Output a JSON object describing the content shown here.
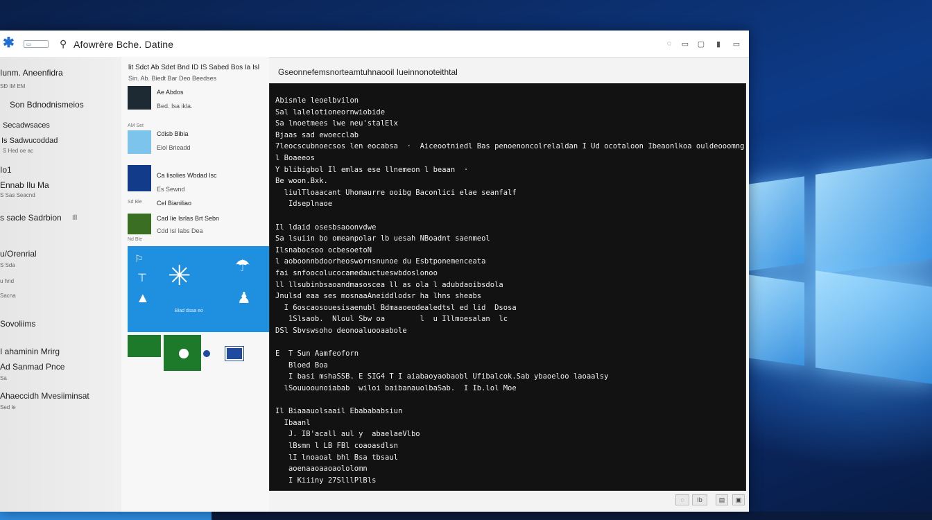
{
  "window": {
    "title": "Afowrère Bche. Datine",
    "small_control": "▭",
    "controls": [
      "◌",
      "▭",
      "▢",
      "▮",
      "▭"
    ]
  },
  "sidebar": {
    "items": [
      {
        "label": "Iunm. Aneenfidra",
        "sub": "SÐ IM EM"
      },
      {
        "label": "Son Bdnodnismeios",
        "sub": ""
      },
      {
        "label": "Secadwsaces",
        "sub": ""
      },
      {
        "label": "Is Sadwucoddad",
        "sub": "S Hed oe ac"
      },
      {
        "label": "Io1",
        "sub": ""
      },
      {
        "label": "Ennab Ilu Ma",
        "sub": "S Sas Seacnd"
      },
      {
        "label": "s sacle Sadrbion",
        "sub": "Ill"
      },
      {
        "label": "u/Orenrial",
        "sub": "S Sda"
      },
      {
        "label": "",
        "sub": "u hnd"
      },
      {
        "label": "",
        "sub": "Sacna"
      },
      {
        "label": "Sovoliims",
        "sub": ""
      },
      {
        "label": "I ahaminin Mrirg",
        "sub": ""
      },
      {
        "label": "Ad Sanmad Pnce",
        "sub": "Sa"
      },
      {
        "label": "Ahaeccidh Mvesiiminsat",
        "sub": "Sed le"
      }
    ]
  },
  "list": {
    "header": "lit Sdct  Ab Sdet Bnd  ID IS Sabed  Bos Ia Isl",
    "sub": "Sin.  Ab. Biedt Bar  Deo Beedses",
    "rows": [
      {
        "title": "Ae Abdos",
        "sub": "Bed. Isa ikla.",
        "tag": ""
      },
      {
        "title": "Cdisb Bibia",
        "sub": "Eiol Brieadd",
        "tag": "AM Set"
      },
      {
        "title": "Ca Iisolies Wbdad Isc",
        "sub": "Es Sewnd",
        "tag": ""
      },
      {
        "title": "Cel Bianiliao",
        "sub": "",
        "tag": "Sd Ble"
      },
      {
        "title": "Cad  Iie Isrlas Brt Sebn",
        "sub": "Cdd  Isl  Iabs  Dea",
        "tag": "Nd Ble"
      }
    ],
    "tile_caption": "Biad dsaa eo"
  },
  "content": {
    "header": "Gseonnefemsnorteamtuhnaooil Iueinnonoteithtal",
    "console_lines": [
      "Abisnle leoelbvilon",
      "Sal lalelotioneornwiobide",
      "Sa lnoetmees lwe neu'stalElx",
      "Bjaas sad ewoecclab",
      "7leocscubnoecsos len eocabsa  ·  Aiceootniedl Bas penoenoncolrelaldan I Ud ocotaloon Ibeaonlkoa ouldeooomng",
      "l Boaeeos",
      "Y blibigbol Il emlas ese llnemeon l beaan  ·",
      "Be woon.Bxk.",
      "  liulTloaacant Uhomaurre ooibg Baconlici elae seanfalf",
      "   Idseplnaoe",
      "",
      "Il ldaid osesbsaoonvdwe",
      "Sa lsuiin bo omeanpolar lb uesah NBoadnt saenmeol",
      "Ilsnabocsoo ocbesoetoN",
      "l aoboonnbdoorheoswornsnunoe du Esbtponemenceata",
      "fai snfoocolucocamedauctueswbdoslonoo",
      "ll llsubinbsaoandmasoscea ll as ola l adubdaoibsdola",
      "Jnulsd eaa ses mosnaaAneiddlodsr ha lhns sheabs",
      "  I 6oscaosouesisaenubl Bdmaaoeodealedtsl ed lid  Dsosa",
      "   1Slsaob.  Nloul Sbw oa        l  u Illmoesalan  lc",
      "DSl Sbvswsoho deonoaluooaabole",
      "",
      "E  T Sun Aamfeoforn",
      "   Bloed Boa",
      "   I basi mshaSSB. E SIG4 T I aiabaoyaobaobl Ufibalcok.Sab ybaoeloo laoaalsy",
      "  lSouuoounoiabab  wiloi baibanauolbaSab.  I Ib.lol Moe",
      "",
      "Il Biaaauolsaail Ebabababsiun",
      "  Ibaanl",
      "   J. IB'acall aul y  abaelaeVlbo",
      "   lBsmn l LB FBl coaoasdlsn",
      "   lI lnoaoal bhl Bsa tbsaul",
      "   aoenaaoaaoaololomn",
      "   I Kiiiny 27SlllPlBls"
    ]
  },
  "statusbar": {
    "controls": [
      "◌",
      "Ib",
      "▤",
      "▣"
    ]
  },
  "colors": {
    "accent": "#1f8fe0",
    "tile_green": "#1d7a2a",
    "console_bg": "#121212",
    "wallpaper": "#0d3a86"
  },
  "icons": {
    "app": "star-icon",
    "tile_icons": [
      "kite-icon",
      "tree-icon",
      "tent-icon",
      "umbrella-icon",
      "triangle-icon",
      "figure-icon"
    ]
  }
}
